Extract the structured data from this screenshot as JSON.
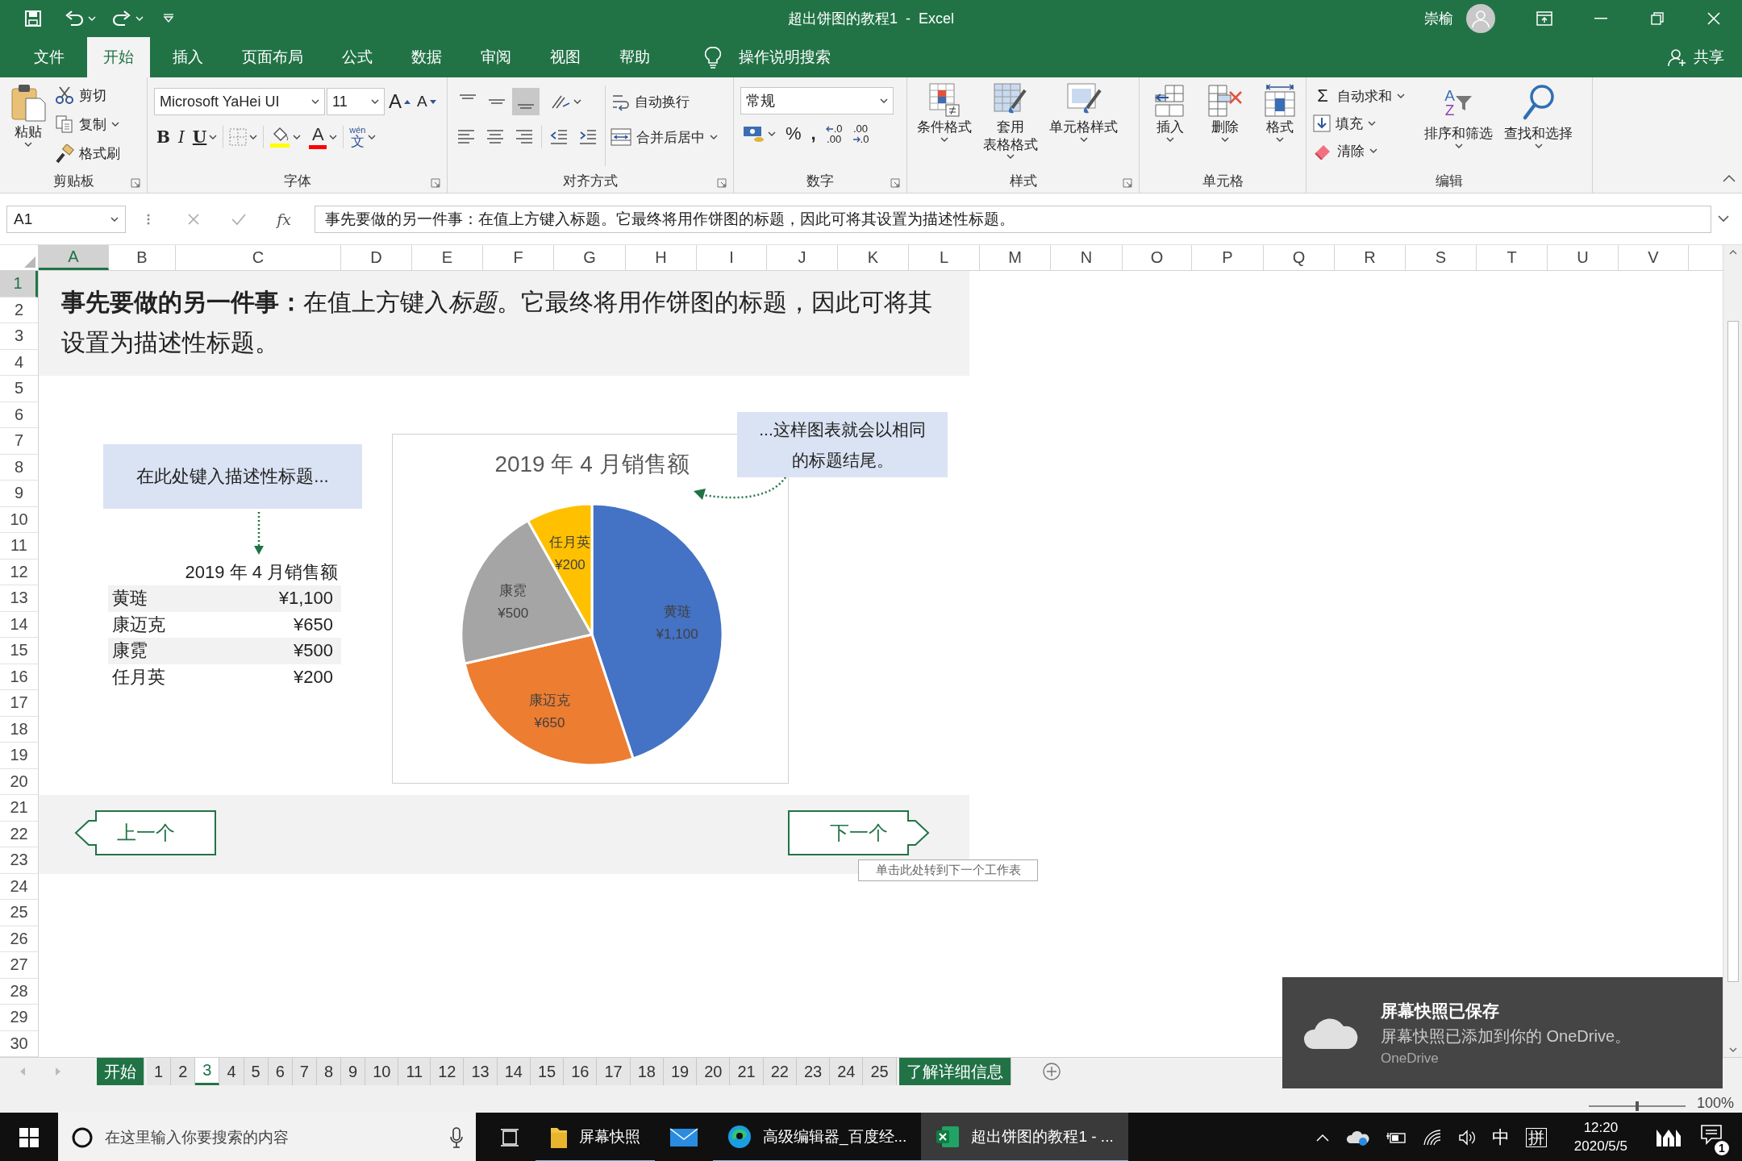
{
  "title_bar": {
    "title": "超出饼图的教程1  -  Excel",
    "user": "崇榆"
  },
  "ribbon_tabs": [
    {
      "label": "文件",
      "selected": false
    },
    {
      "label": "开始",
      "selected": true
    },
    {
      "label": "插入",
      "selected": false
    },
    {
      "label": "页面布局",
      "selected": false
    },
    {
      "label": "公式",
      "selected": false
    },
    {
      "label": "数据",
      "selected": false
    },
    {
      "label": "审阅",
      "selected": false
    },
    {
      "label": "视图",
      "selected": false
    },
    {
      "label": "帮助",
      "selected": false
    }
  ],
  "tell_me": "操作说明搜索",
  "share": "共享",
  "ribbon_groups": [
    {
      "kind": "clipboard",
      "name": "剪贴板",
      "paste": "粘贴",
      "commands": [
        "剪切",
        "复制",
        "格式刷"
      ]
    },
    {
      "kind": "font",
      "name": "字体",
      "font_name": "Microsoft YaHei UI",
      "font_size": "11",
      "size_buttons": [
        "A",
        "A"
      ],
      "style_buttons": [
        "B",
        "I",
        "U"
      ],
      "font_color": "A",
      "phonetic": [
        "wén",
        "文"
      ]
    },
    {
      "kind": "alignment",
      "name": "对齐方式",
      "vertical_align": [
        {
          "selected": false
        },
        {
          "selected": false
        },
        {
          "selected": true
        }
      ],
      "wrap_text": "自动换行",
      "merge": "合并后居中"
    },
    {
      "kind": "number",
      "name": "数字",
      "format": "常规",
      "symbols": [
        "%",
        ","
      ],
      "decimals": [
        [
          ".0",
          ".00"
        ],
        [
          ".00",
          ".0"
        ]
      ]
    },
    {
      "kind": "styles",
      "name": "样式",
      "commands": [
        [
          "条件格式"
        ],
        [
          "套用",
          "表格格式"
        ],
        [
          "单元格样式"
        ]
      ]
    },
    {
      "kind": "cells",
      "name": "单元格",
      "commands": [
        "插入",
        "删除",
        "格式"
      ]
    },
    {
      "kind": "editing",
      "name": "编辑",
      "autosum_symbol": "Σ",
      "commands": [
        "自动求和",
        "填充",
        "清除"
      ],
      "sort_letters": [
        "A",
        "Z"
      ],
      "large_commands": [
        "排序和筛选",
        "查找和选择"
      ]
    }
  ],
  "formula_bar": {
    "name_box": "A1",
    "function_label": "fx",
    "formula": "事先要做的另一件事：在值上方键入标题。它最终将用作饼图的标题，因此可将其设置为描述性标题。"
  },
  "columns": [
    {
      "label": "A",
      "selected": true
    },
    {
      "label": "B",
      "selected": false
    },
    {
      "label": "C",
      "selected": false
    },
    {
      "label": "D",
      "selected": false
    },
    {
      "label": "E",
      "selected": false
    },
    {
      "label": "F",
      "selected": false
    },
    {
      "label": "G",
      "selected": false
    },
    {
      "label": "H",
      "selected": false
    },
    {
      "label": "I",
      "selected": false
    },
    {
      "label": "J",
      "selected": false
    },
    {
      "label": "K",
      "selected": false
    },
    {
      "label": "L",
      "selected": false
    },
    {
      "label": "M",
      "selected": false
    },
    {
      "label": "N",
      "selected": false
    },
    {
      "label": "O",
      "selected": false
    },
    {
      "label": "P",
      "selected": false
    },
    {
      "label": "Q",
      "selected": false
    },
    {
      "label": "R",
      "selected": false
    },
    {
      "label": "S",
      "selected": false
    },
    {
      "label": "T",
      "selected": false
    },
    {
      "label": "U",
      "selected": false
    },
    {
      "label": "V",
      "selected": false
    }
  ],
  "rows": [
    {
      "label": "1",
      "selected": true
    },
    {
      "label": "2",
      "selected": false
    },
    {
      "label": "3",
      "selected": false
    },
    {
      "label": "4",
      "selected": false
    },
    {
      "label": "5",
      "selected": false
    },
    {
      "label": "6",
      "selected": false
    },
    {
      "label": "7",
      "selected": false
    },
    {
      "label": "8",
      "selected": false
    },
    {
      "label": "9",
      "selected": false
    },
    {
      "label": "10",
      "selected": false
    },
    {
      "label": "11",
      "selected": false
    },
    {
      "label": "12",
      "selected": false
    },
    {
      "label": "13",
      "selected": false
    },
    {
      "label": "14",
      "selected": false
    },
    {
      "label": "15",
      "selected": false
    },
    {
      "label": "16",
      "selected": false
    },
    {
      "label": "17",
      "selected": false
    },
    {
      "label": "18",
      "selected": false
    },
    {
      "label": "19",
      "selected": false
    },
    {
      "label": "20",
      "selected": false
    },
    {
      "label": "21",
      "selected": false
    },
    {
      "label": "22",
      "selected": false
    },
    {
      "label": "23",
      "selected": false
    },
    {
      "label": "24",
      "selected": false
    },
    {
      "label": "25",
      "selected": false
    },
    {
      "label": "26",
      "selected": false
    },
    {
      "label": "27",
      "selected": false
    },
    {
      "label": "28",
      "selected": false
    },
    {
      "label": "29",
      "selected": false
    },
    {
      "label": "30",
      "selected": false
    }
  ],
  "sheet": {
    "intro": [
      {
        "kind": "bold",
        "text": "事先要做的另一件事："
      },
      {
        "kind": "plain",
        "text": "在值上方键入"
      },
      {
        "kind": "italic",
        "text": "标题"
      },
      {
        "kind": "plain",
        "text": "。它最终将用作饼图的标题，因此可将其设置为描述性标题。"
      }
    ],
    "title_hint": "在此处键入描述性标题...",
    "sales_table": {
      "title": "2019 年 4 月销售额",
      "rows": [
        {
          "name": "黄琏",
          "amount": "¥1,100"
        },
        {
          "name": "康迈克",
          "amount": "¥650"
        },
        {
          "name": "康霓",
          "amount": "¥500"
        },
        {
          "name": "任月英",
          "amount": "¥200"
        }
      ]
    },
    "chart": {
      "chart_data": {
        "type": "pie",
        "title": "2019 年 4 月销售额",
        "categories": [
          "黄琏",
          "康迈克",
          "康霓",
          "任月英"
        ],
        "series": [
          {
            "values": [
              44.9,
              26.53,
              20.41,
              8.16
            ]
          }
        ],
        "value_labels": [
          "¥1,100",
          "¥650",
          "¥500",
          "¥200"
        ]
      }
    },
    "callout": "...这样图表就会以相同的标题结尾。",
    "previous_button": "上一个",
    "next_button": "下一个",
    "tooltip": "单击此处转到下一个工作表"
  },
  "sheet_tabs": [
    {
      "label": "开始",
      "kind": "link",
      "selected": false
    },
    {
      "label": "1",
      "kind": "sheet",
      "selected": false
    },
    {
      "label": "2",
      "kind": "sheet",
      "selected": false
    },
    {
      "label": "3",
      "kind": "sheet",
      "selected": true
    },
    {
      "label": "4",
      "kind": "sheet",
      "selected": false
    },
    {
      "label": "5",
      "kind": "sheet",
      "selected": false
    },
    {
      "label": "6",
      "kind": "sheet",
      "selected": false
    },
    {
      "label": "7",
      "kind": "sheet",
      "selected": false
    },
    {
      "label": "8",
      "kind": "sheet",
      "selected": false
    },
    {
      "label": "9",
      "kind": "sheet",
      "selected": false
    },
    {
      "label": "10",
      "kind": "sheet",
      "selected": false
    },
    {
      "label": "11",
      "kind": "sheet",
      "selected": false
    },
    {
      "label": "12",
      "kind": "sheet",
      "selected": false
    },
    {
      "label": "13",
      "kind": "sheet",
      "selected": false
    },
    {
      "label": "14",
      "kind": "sheet",
      "selected": false
    },
    {
      "label": "15",
      "kind": "sheet",
      "selected": false
    },
    {
      "label": "16",
      "kind": "sheet",
      "selected": false
    },
    {
      "label": "17",
      "kind": "sheet",
      "selected": false
    },
    {
      "label": "18",
      "kind": "sheet",
      "selected": false
    },
    {
      "label": "19",
      "kind": "sheet",
      "selected": false
    },
    {
      "label": "20",
      "kind": "sheet",
      "selected": false
    },
    {
      "label": "21",
      "kind": "sheet",
      "selected": false
    },
    {
      "label": "22",
      "kind": "sheet",
      "selected": false
    },
    {
      "label": "23",
      "kind": "sheet",
      "selected": false
    },
    {
      "label": "24",
      "kind": "sheet",
      "selected": false
    },
    {
      "label": "25",
      "kind": "sheet",
      "selected": false
    },
    {
      "label": "了解详细信息",
      "kind": "link",
      "selected": false
    }
  ],
  "status_bar": {
    "zoom_slider": {
      "level": 0.5
    },
    "zoom": "100%"
  },
  "notification": {
    "title": "屏幕快照已保存",
    "message": "屏幕快照已添加到你的 OneDrive。",
    "source": "OneDrive"
  },
  "taskbar": {
    "search_placeholder": "在这里输入你要搜索的内容",
    "apps": [
      {
        "kind": "folder",
        "label": "屏幕快照",
        "running": true,
        "selected": false
      },
      {
        "kind": "mail",
        "running": false,
        "selected": false
      },
      {
        "kind": "edge",
        "label": "高级编辑器_百度经...",
        "running": true,
        "selected": false
      },
      {
        "kind": "excel",
        "label": "超出饼图的教程1 - ...",
        "running": true,
        "selected": true
      }
    ],
    "tray": {
      "ime_mode": "中",
      "ime": "拼",
      "time": "12:20",
      "date": "2020/5/5",
      "notifications": "1"
    }
  }
}
